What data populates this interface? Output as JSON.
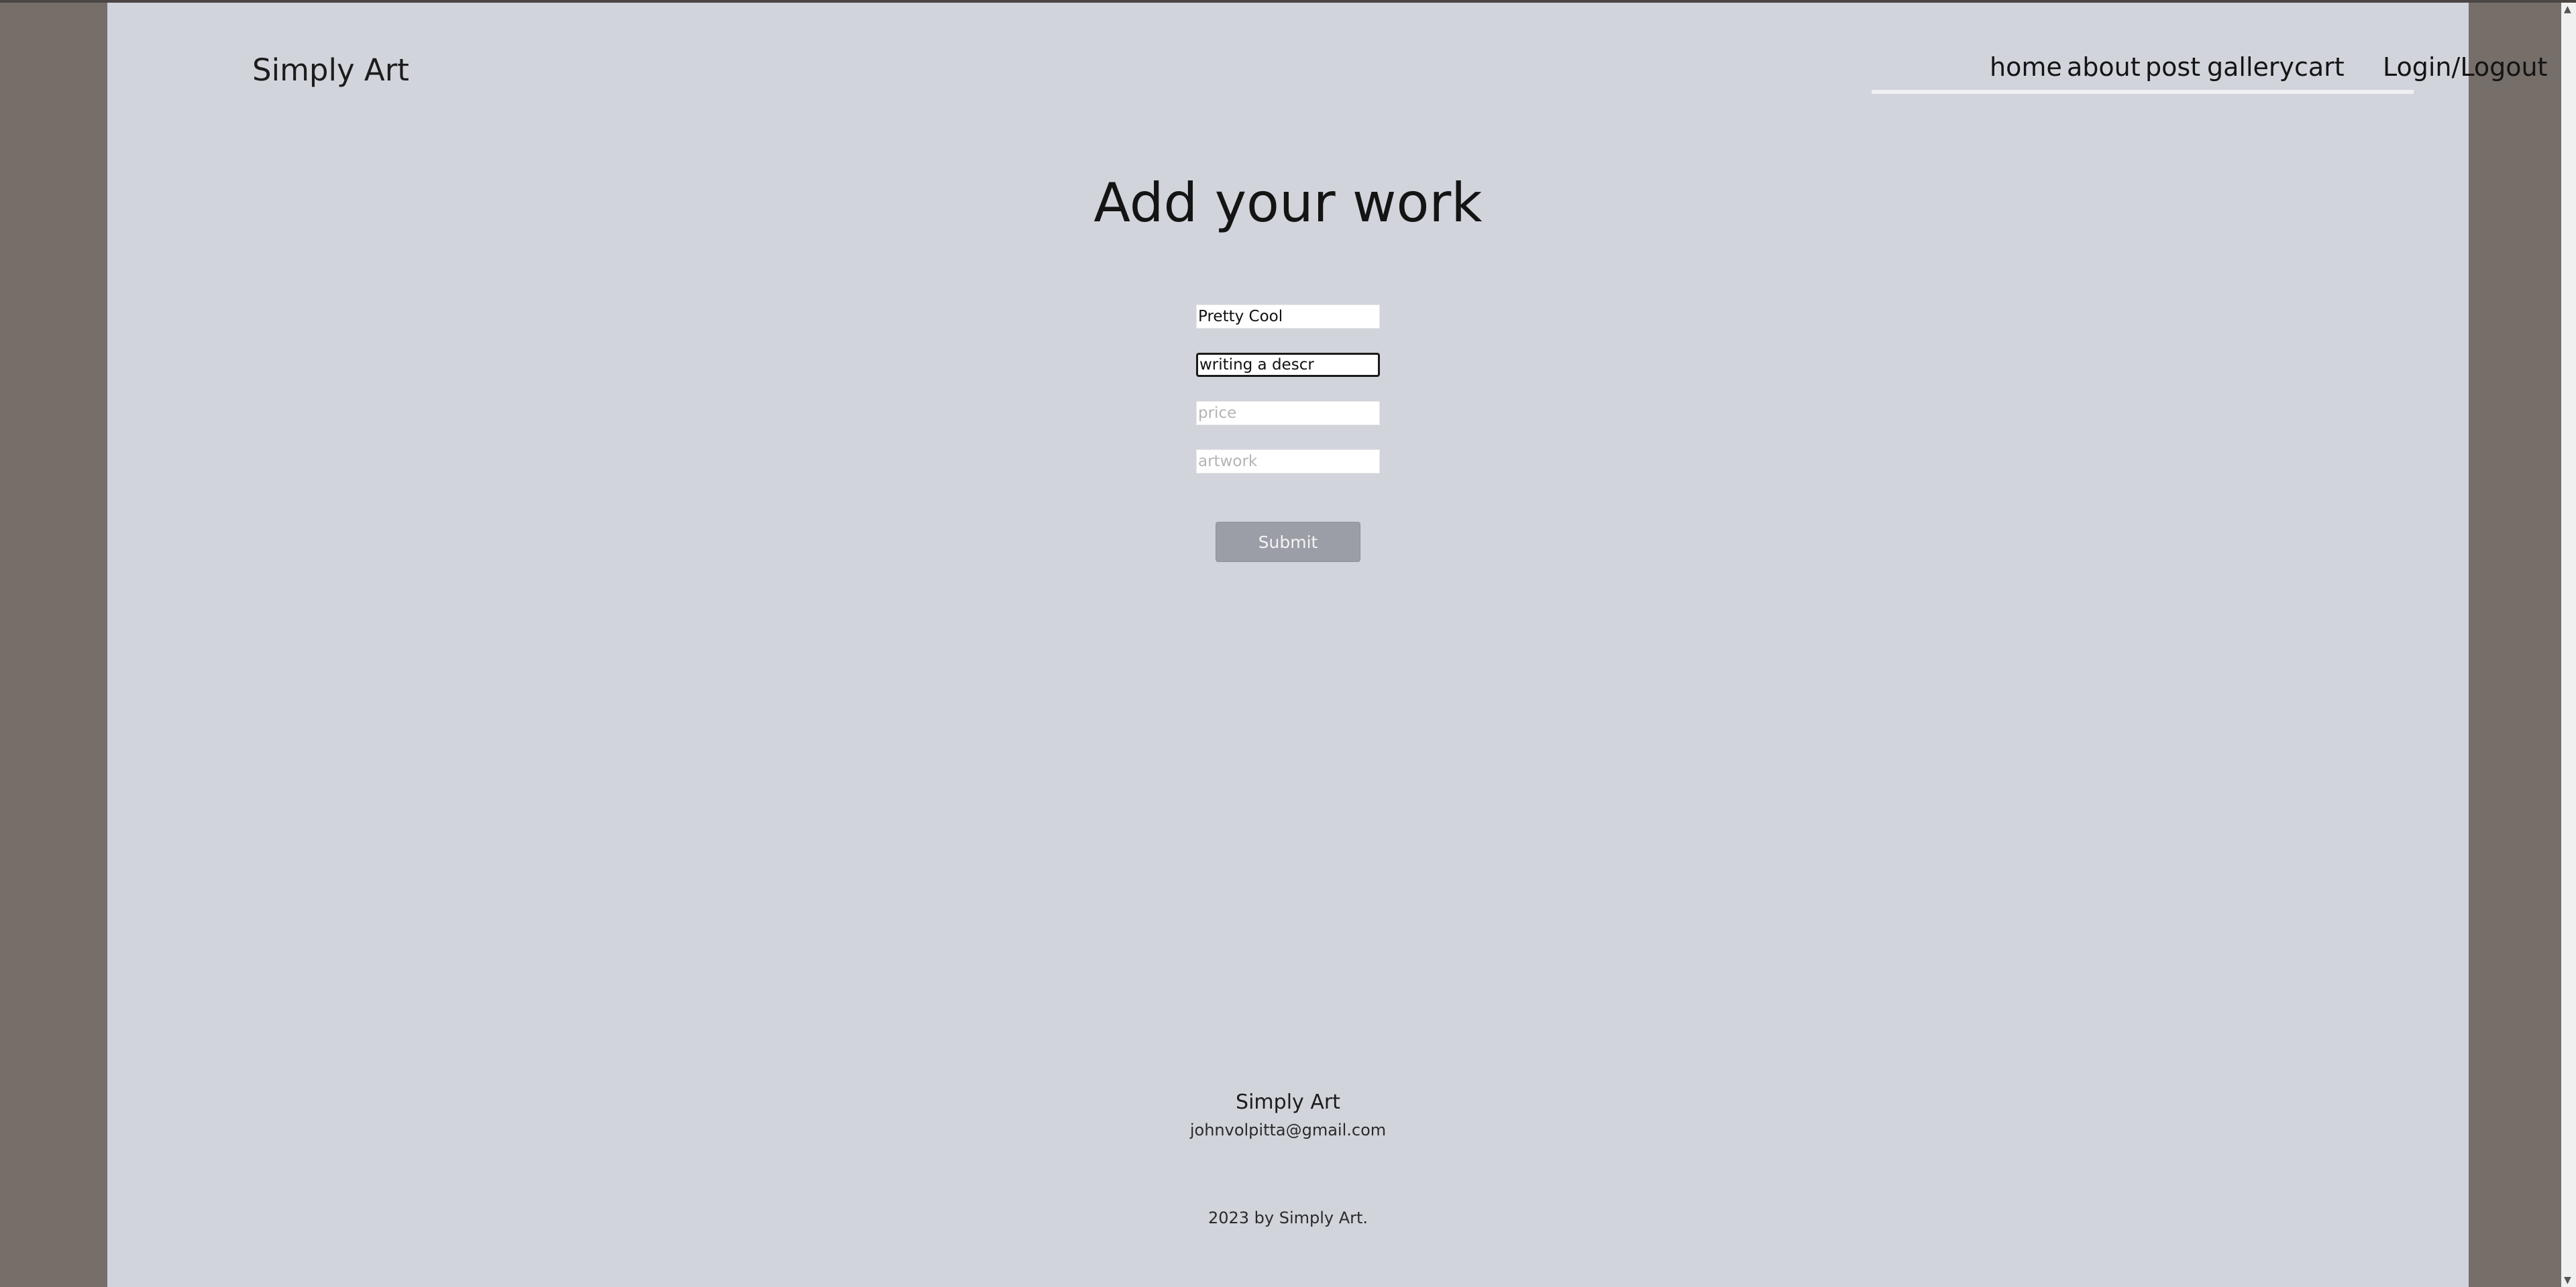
{
  "site": {
    "logo": "Simply Art"
  },
  "nav": {
    "items": [
      {
        "label": "home"
      },
      {
        "label": "about"
      },
      {
        "label": "post"
      },
      {
        "label": "gallery"
      },
      {
        "label": "cart"
      }
    ],
    "auth_label": "Login/Logout"
  },
  "main": {
    "title": "Add your work",
    "form": {
      "title_field": {
        "value": "Pretty Cool",
        "placeholder": ""
      },
      "description_field": {
        "value": "writing a descr",
        "placeholder": ""
      },
      "price_field": {
        "value": "",
        "placeholder": "price"
      },
      "artwork_field": {
        "value": "",
        "placeholder": "artwork"
      },
      "submit_label": "Submit"
    }
  },
  "footer": {
    "name": "Simply Art",
    "email": "johnvolpitta@gmail.com",
    "copyright": "2023 by Simply Art."
  },
  "colors": {
    "outer_background": "#756e69",
    "page_background": "#d2d4dc",
    "button": "#9b9ea7"
  }
}
